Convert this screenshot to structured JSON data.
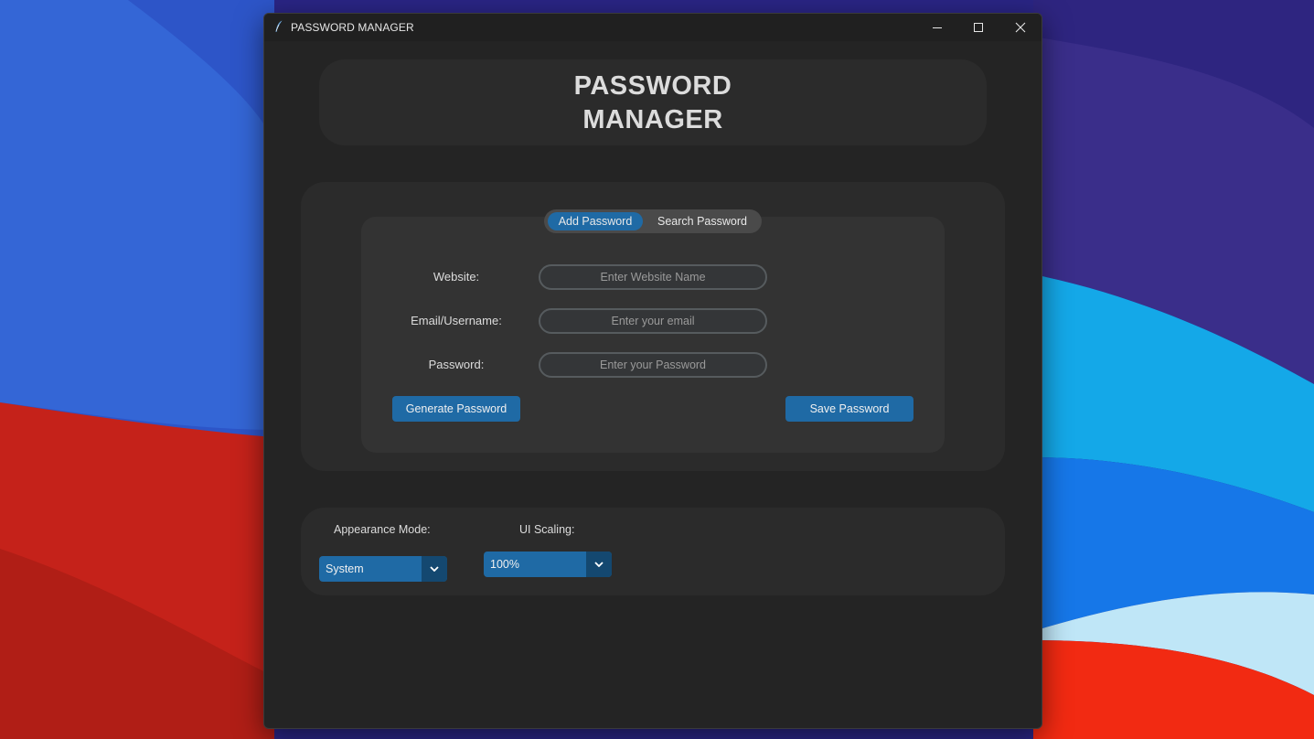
{
  "window": {
    "title": "PASSWORD MANAGER",
    "controls": [
      "minimize-icon",
      "maximize-icon",
      "close-icon"
    ]
  },
  "header": {
    "title_line1": "PASSWORD",
    "title_line2": "MANAGER"
  },
  "tabs": {
    "items": [
      {
        "label": "Add Password",
        "selected": true
      },
      {
        "label": "Search Password",
        "selected": false
      }
    ]
  },
  "form": {
    "website_label": "Website:",
    "website_placeholder": "Enter Website Name",
    "email_label": "Email/Username:",
    "email_placeholder": "Enter your email",
    "password_label": "Password:",
    "password_placeholder": "Enter your Password",
    "generate_label": "Generate Password",
    "save_label": "Save Password"
  },
  "settings": {
    "appearance_label": "Appearance Mode:",
    "appearance_value": "System",
    "scaling_label": "UI Scaling:",
    "scaling_value": "100%"
  },
  "colors": {
    "accent": "#1f6aa5",
    "accent_dark": "#144870",
    "window_bg": "#242424",
    "panel_bg": "#2b2b2b"
  }
}
